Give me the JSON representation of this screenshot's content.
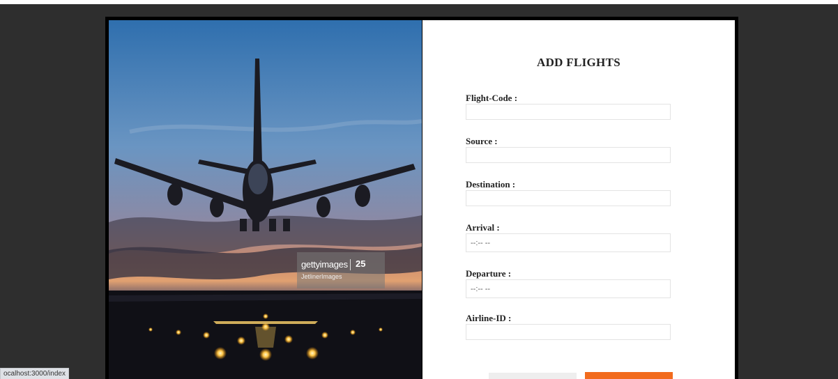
{
  "form": {
    "title": "ADD FLIGHTS",
    "fields": [
      {
        "label": "Flight-Code :",
        "value": ""
      },
      {
        "label": "Source :",
        "value": ""
      },
      {
        "label": "Destination :",
        "value": ""
      },
      {
        "label": "Arrival :",
        "value": "--:-- --"
      },
      {
        "label": "Departure :",
        "value": "--:-- --"
      },
      {
        "label": "Airline-ID :",
        "value": ""
      }
    ],
    "reset_label": "",
    "submit_label": ""
  },
  "image": {
    "watermark_brand": "gettyimages",
    "watermark_badge": "25",
    "watermark_credit": "JetlinerImages"
  },
  "status_bar": {
    "url": "ocalhost:3000/index"
  },
  "colors": {
    "page_background": "#2e2e2e",
    "card_border": "#000000",
    "accent": "#f26b1d"
  }
}
